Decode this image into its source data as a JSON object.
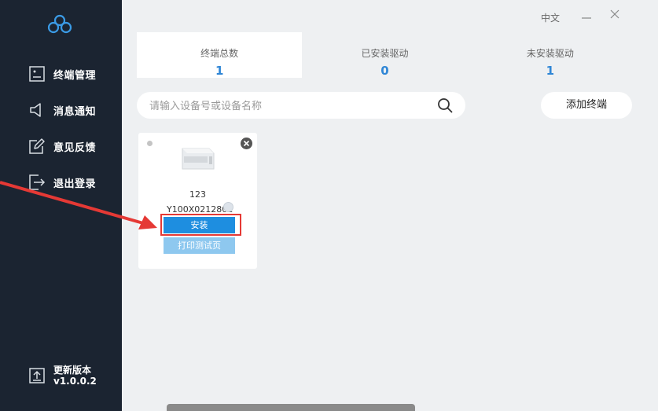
{
  "sidebar": {
    "logo_icon": "cloud-link-icon",
    "items": [
      {
        "label": "终端管理",
        "icon": "terminal-icon"
      },
      {
        "label": "消息通知",
        "icon": "speaker-icon"
      },
      {
        "label": "意见反馈",
        "icon": "feedback-icon"
      },
      {
        "label": "退出登录",
        "icon": "logout-icon"
      }
    ],
    "update": {
      "label": "更新版本",
      "version": "v1.0.0.2",
      "icon": "upload-icon"
    }
  },
  "header": {
    "language": "中文"
  },
  "stats": [
    {
      "label": "终端总数",
      "value": "1"
    },
    {
      "label": "已安装驱动",
      "value": "0"
    },
    {
      "label": "未安装驱动",
      "value": "1"
    }
  ],
  "search": {
    "placeholder": "请输入设备号或设备名称"
  },
  "toolbar": {
    "add_label": "添加终端"
  },
  "device": {
    "name": "123",
    "id": "Y100X0212801",
    "install_label": "安装",
    "test_label": "打印测试页"
  },
  "colors": {
    "accent": "#2f86d6",
    "sidebar": "#1b2431",
    "highlight": "#e53935"
  }
}
